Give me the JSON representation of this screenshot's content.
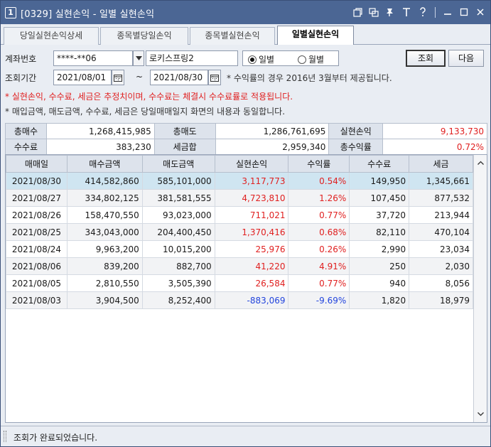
{
  "window": {
    "number": "1",
    "title": "[0329] 실현손익 - 일별 실현손익"
  },
  "tabs": [
    {
      "label": "당일실현손익상세"
    },
    {
      "label": "종목별당일손익"
    },
    {
      "label": "종목별실현손익"
    },
    {
      "label": "일별실현손익",
      "active": true
    }
  ],
  "query": {
    "account_label": "계좌번호",
    "account_value": "****-**06",
    "account_name": "로키스프링2",
    "radio_daily": "일별",
    "radio_monthly": "월별",
    "selected_radio": "일별",
    "search_button": "조회",
    "next_button": "다음",
    "period_label": "조회기간",
    "date_from": "2021/08/01",
    "date_sep": "~",
    "date_to": "2021/08/30",
    "notice_rate": "* 수익률의 경우 2016년 3월부터 제공됩니다.",
    "notice_red": "* 실현손익, 수수료, 세금은 추정치이며, 수수료는 체결시 수수료률로 적용됩니다.",
    "notice_black": "* 매입금액, 매도금액, 수수료, 세금은 당일매매일지 화면의 내용과 동일합니다."
  },
  "summary": {
    "total_buy_label": "총매수",
    "total_buy": "1,268,415,985",
    "total_sell_label": "총매도",
    "total_sell": "1,286,761,695",
    "realized_label": "실현손익",
    "realized": "9,133,730",
    "fee_label": "수수료",
    "fee": "383,230",
    "tax_label": "세금합",
    "tax": "2,959,340",
    "return_label": "총수익률",
    "return": "0.72%"
  },
  "grid": {
    "columns": [
      "매매일",
      "매수금액",
      "매도금액",
      "실현손익",
      "수익률",
      "수수료",
      "세금"
    ],
    "rows": [
      {
        "date": "2021/08/30",
        "buy": "414,582,860",
        "sell": "585,101,000",
        "pnl": "3,117,773",
        "rate": "0.54%",
        "fee": "149,950",
        "tax": "1,345,661",
        "sign": "pos"
      },
      {
        "date": "2021/08/27",
        "buy": "334,802,125",
        "sell": "381,581,555",
        "pnl": "4,723,810",
        "rate": "1.26%",
        "fee": "107,450",
        "tax": "877,532",
        "sign": "pos"
      },
      {
        "date": "2021/08/26",
        "buy": "158,470,550",
        "sell": "93,023,000",
        "pnl": "711,021",
        "rate": "0.77%",
        "fee": "37,720",
        "tax": "213,944",
        "sign": "pos"
      },
      {
        "date": "2021/08/25",
        "buy": "343,043,000",
        "sell": "204,400,450",
        "pnl": "1,370,416",
        "rate": "0.68%",
        "fee": "82,110",
        "tax": "470,104",
        "sign": "pos"
      },
      {
        "date": "2021/08/24",
        "buy": "9,963,200",
        "sell": "10,015,200",
        "pnl": "25,976",
        "rate": "0.26%",
        "fee": "2,990",
        "tax": "23,034",
        "sign": "pos"
      },
      {
        "date": "2021/08/06",
        "buy": "839,200",
        "sell": "882,700",
        "pnl": "41,220",
        "rate": "4.91%",
        "fee": "250",
        "tax": "2,030",
        "sign": "pos"
      },
      {
        "date": "2021/08/05",
        "buy": "2,810,550",
        "sell": "3,505,390",
        "pnl": "26,584",
        "rate": "0.77%",
        "fee": "940",
        "tax": "8,056",
        "sign": "pos"
      },
      {
        "date": "2021/08/03",
        "buy": "3,904,500",
        "sell": "8,252,400",
        "pnl": "-883,069",
        "rate": "-9.69%",
        "fee": "1,820",
        "tax": "18,979",
        "sign": "neg"
      }
    ]
  },
  "status": {
    "text": "조회가 완료되었습니다."
  },
  "colors": {
    "titlebar": "#4b6694",
    "positive": "#e02020",
    "negative": "#2244dd",
    "selected_row": "#cfe5f1"
  }
}
